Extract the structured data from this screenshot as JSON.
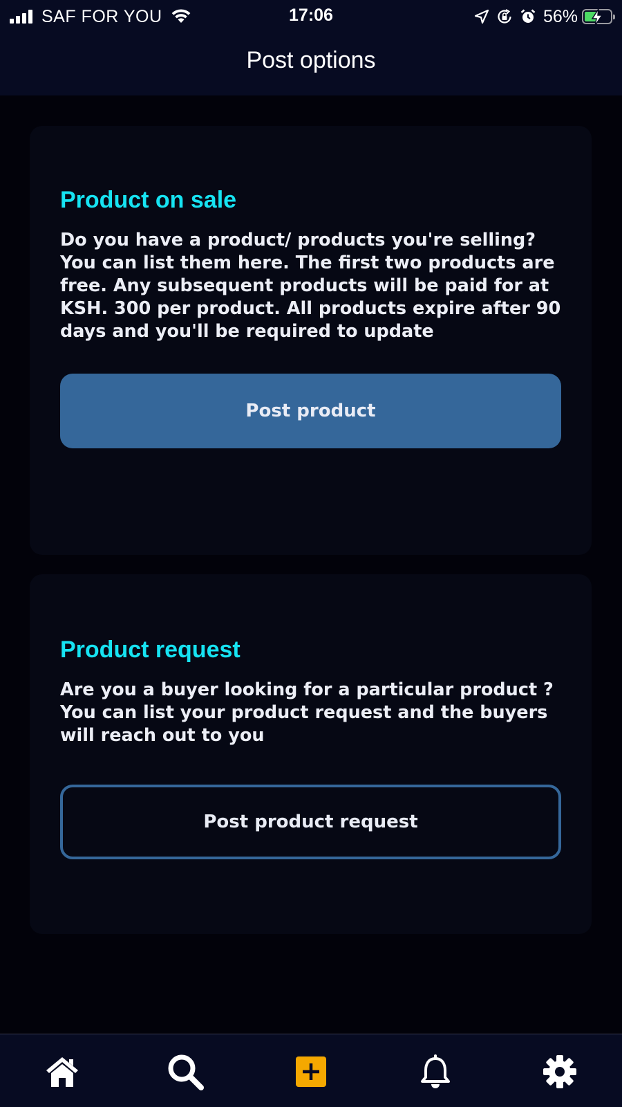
{
  "status_bar": {
    "carrier": "SAF FOR YOU",
    "time": "17:06",
    "battery_percent": "56%",
    "battery_level": 0.56,
    "signal_bars": 4,
    "icons": [
      "signal-icon",
      "wifi-icon",
      "location-arrow-icon",
      "orientation-lock-icon",
      "alarm-icon",
      "battery-charging-icon"
    ]
  },
  "header": {
    "title": "Post options"
  },
  "cards": [
    {
      "title": "Product on sale",
      "description": "Do you have a product/ products you're selling? You can list them here. The first two products are free. Any subsequent products will be paid for at KSH. 300 per product. All products expire after 90 days and you'll be required to update",
      "button_label": "Post product"
    },
    {
      "title": "Product request",
      "description": "Are you a buyer looking for a particular product ? You can list your product request and the buyers will reach out to you",
      "button_label": "Post product request"
    }
  ],
  "tab_bar": {
    "items": [
      {
        "icon": "home-icon"
      },
      {
        "icon": "search-icon"
      },
      {
        "icon": "add-icon",
        "active": true
      },
      {
        "icon": "bell-icon"
      },
      {
        "icon": "gear-icon"
      }
    ]
  },
  "colors": {
    "background": "#02020a",
    "bar_background": "#070b22",
    "card_background": "#060814",
    "title_accent": "#16e3f2",
    "button_blue": "#35679a",
    "active_tab": "#f5a800",
    "battery_green": "#4cd964"
  }
}
